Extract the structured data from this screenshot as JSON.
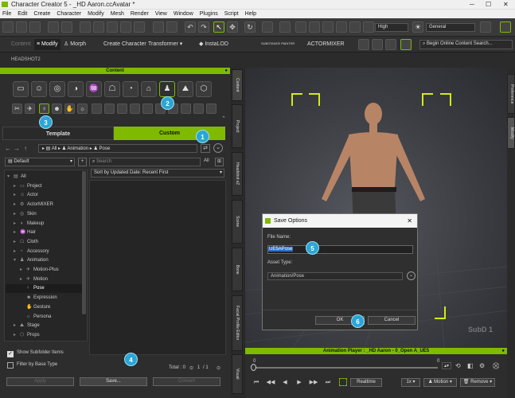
{
  "window": {
    "title": "Character Creator 5 - _HD Aaron.ccAvatar *"
  },
  "menu": [
    "File",
    "Edit",
    "Create",
    "Character",
    "Modify",
    "Mesh",
    "Render",
    "View",
    "Window",
    "Plugins",
    "Script",
    "Help"
  ],
  "toolbar1": {
    "quality": "High",
    "mode": "General"
  },
  "toolbar2": {
    "content": "Content",
    "modify": "Modify",
    "morph": "Morph",
    "create_character": "Create Character",
    "transformer": "Transformer",
    "instalod": "InstaLOD",
    "substance": "SUBSTANCE PAINTER",
    "actormixer": "ACTORMIXER",
    "search_placeholder": "Begin Online Content Search..."
  },
  "headshot": {
    "label": "HEADSHOT2"
  },
  "content_panel": {
    "title": "Content",
    "tab_template": "Template",
    "tab_custom": "Custom",
    "path": [
      "All",
      "Animation",
      "Pose"
    ],
    "filter": "Default",
    "search_placeholder": "Search",
    "search_scope": "All",
    "sort": "Sort by Updated Date: Recent First",
    "tree": [
      {
        "label": "All",
        "depth": 0,
        "arrow": "▾"
      },
      {
        "label": "Project",
        "depth": 1,
        "arrow": "▸"
      },
      {
        "label": "Actor",
        "depth": 1,
        "arrow": "▸"
      },
      {
        "label": "ActorMIXER",
        "depth": 1,
        "arrow": "▸"
      },
      {
        "label": "Skin",
        "depth": 1,
        "arrow": "▸"
      },
      {
        "label": "Makeup",
        "depth": 1,
        "arrow": "▸"
      },
      {
        "label": "Hair",
        "depth": 1,
        "arrow": "▸"
      },
      {
        "label": "Cloth",
        "depth": 1,
        "arrow": "▸"
      },
      {
        "label": "Accessory",
        "depth": 1,
        "arrow": "▸"
      },
      {
        "label": "Animation",
        "depth": 1,
        "arrow": "▾"
      },
      {
        "label": "Motion-Plus",
        "depth": 2,
        "arrow": "▸"
      },
      {
        "label": "Motion",
        "depth": 2,
        "arrow": "▸"
      },
      {
        "label": "Pose",
        "depth": 2,
        "arrow": "",
        "selected": true
      },
      {
        "label": "Expression",
        "depth": 2,
        "arrow": ""
      },
      {
        "label": "Gesture",
        "depth": 2,
        "arrow": ""
      },
      {
        "label": "Persona",
        "depth": 2,
        "arrow": ""
      },
      {
        "label": "Stage",
        "depth": 1,
        "arrow": "▸"
      },
      {
        "label": "Props",
        "depth": 1,
        "arrow": "▸"
      }
    ],
    "show_subfolder": "Show Subfolder Items",
    "filter_base": "Filter by Base Type",
    "total": "Total : 0",
    "page": "1",
    "pages": "/ 1",
    "btn_apply": "Apply",
    "btn_save": "Save...",
    "btn_convert": "Convert"
  },
  "side_tabs_mid": [
    "Content",
    "Project",
    "Headshot v2",
    "Scene",
    "Bone",
    "Facial Profile Editor",
    "Visual"
  ],
  "side_tabs_right": [
    "Preference",
    "Modify"
  ],
  "viewport": {
    "subd": "SubD 1"
  },
  "dialog": {
    "title": "Save Options",
    "file_name_label": "File Name:",
    "file_name_value": "UE5APose",
    "asset_type_label": "Asset Type:",
    "asset_type_value": "Animation/Pose",
    "ok": "OK",
    "cancel": "Cancel"
  },
  "anim": {
    "title": "Animation Player : _HD Aaron - 0_Open A_UE5",
    "realtime": "Realtime",
    "speed": "1x",
    "motion": "Motion",
    "remove": "Remove",
    "start": "0",
    "end": "0"
  },
  "badges": [
    "1",
    "2",
    "3",
    "4",
    "5",
    "6"
  ],
  "accent": "#7fba00"
}
